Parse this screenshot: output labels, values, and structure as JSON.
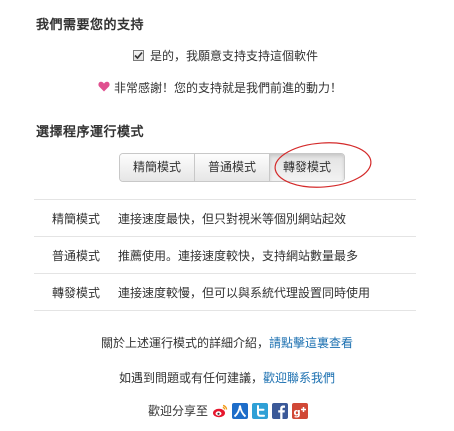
{
  "support": {
    "title": "我們需要您的支持",
    "checkbox_label": "是的，我願意支持支持這個軟件",
    "checkbox_checked": true,
    "thanks_text": "非常感謝！您的支持就是我們前進的動力！"
  },
  "mode": {
    "title": "選擇程序運行模式",
    "buttons": [
      {
        "label": "精簡模式"
      },
      {
        "label": "普通模式"
      },
      {
        "label": "轉發模式"
      }
    ],
    "selected": "轉發模式",
    "rows": [
      {
        "name": "精簡模式",
        "desc": "連接速度最快，但只對視米等個別網站起效"
      },
      {
        "name": "普通模式",
        "desc": "推薦使用。連接速度較快，支持網站數量最多"
      },
      {
        "name": "轉發模式",
        "desc": "連接速度較慢，但可以與系統代理設置同時使用"
      }
    ]
  },
  "info": {
    "intro_text": "關於上述運行模式的詳細介紹，",
    "intro_link": "請點擊這裏查看",
    "contact_text": "如遇到問題或有任何建議，",
    "contact_link": "歡迎聯系我們"
  },
  "share": {
    "label": "歡迎分享至",
    "icons": [
      "weibo-icon",
      "renren-icon",
      "twitter-icon",
      "facebook-icon",
      "google-plus-icon"
    ]
  },
  "colors": {
    "link": "#1a6fb0",
    "heart": "#e0508f",
    "annotation_ellipse": "#d42a2a",
    "weibo": "#e6162d",
    "renren": "#1d6dc9",
    "twitter": "#2fa0d6",
    "facebook": "#3b5998",
    "google_plus": "#d14836"
  }
}
